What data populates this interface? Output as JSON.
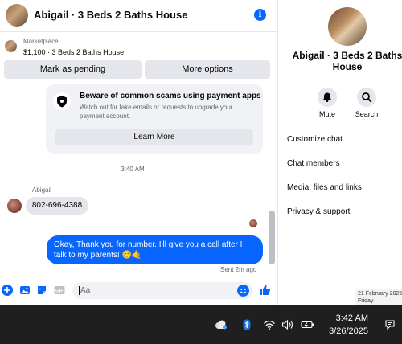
{
  "header": {
    "title": "Abigail · 3 Beds 2 Baths House",
    "info_icon": "info-icon",
    "accent": "#0866ff"
  },
  "marketplace": {
    "label": "Marketplace",
    "listing": "$1,100 · 3 Beds 2 Baths House",
    "mark_pending_label": "Mark as pending",
    "more_options_label": "More options"
  },
  "scam_notice": {
    "title": "Beware of common scams using payment apps",
    "body": "Watch out for fake emails or requests to upgrade your payment account.",
    "learn_more_label": "Learn More",
    "icon": "shield-icon"
  },
  "messages": {
    "time_separator": "3:40 AM",
    "sender_name": "Abigail",
    "incoming_text": "802-696-4388",
    "outgoing_text": "Okay, Thank you for number. I'll give you a call after I talk to my parents! 😊🤙",
    "sent_status": "Sent 2m ago"
  },
  "composer": {
    "placeholder": "Aa",
    "icons": [
      "plus-icon",
      "image-icon",
      "sticker-icon",
      "gif-icon",
      "emoji-icon",
      "thumbs-up-icon"
    ]
  },
  "details_panel": {
    "title": "Abigail · 3 Beds 2 Baths House",
    "mute_label": "Mute",
    "search_label": "Search",
    "items": [
      "Customize chat",
      "Chat members",
      "Media, files and links",
      "Privacy & support"
    ]
  },
  "tooltip": {
    "line1": "21 February 2025",
    "line2": "Friday"
  },
  "taskbar": {
    "time": "3:42 AM",
    "date": "3/26/2025",
    "tray_icons": [
      "weather-icon",
      "bluetooth-icon",
      "wifi-icon",
      "volume-icon",
      "battery-icon",
      "notification-icon"
    ]
  }
}
